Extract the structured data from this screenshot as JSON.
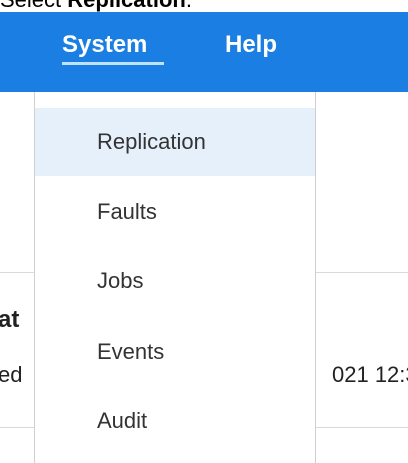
{
  "caption": {
    "prefix": "Select ",
    "bold": "Replication",
    "suffix": "."
  },
  "topnav": {
    "items": [
      {
        "label": "System",
        "active": true
      },
      {
        "label": "Help",
        "active": false
      }
    ]
  },
  "background": {
    "partial_heading": "at",
    "partial_text_left": "ed",
    "partial_text_right": "021 12:3"
  },
  "menu": {
    "items": [
      {
        "label": "Replication",
        "highlighted": true
      },
      {
        "label": "Faults",
        "highlighted": false
      },
      {
        "label": "Jobs",
        "highlighted": false
      },
      {
        "label": "Events",
        "highlighted": false
      },
      {
        "label": "Audit",
        "highlighted": false
      }
    ]
  },
  "colors": {
    "topbar": "#1a7ee3",
    "highlight": "#e6f0fb",
    "underline": "#bfe2ff"
  }
}
